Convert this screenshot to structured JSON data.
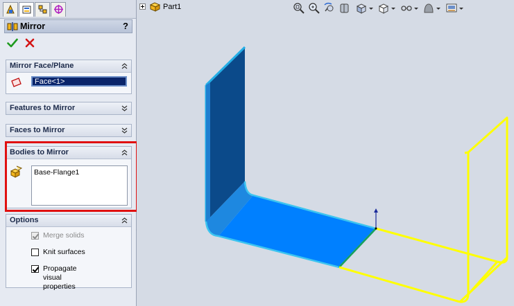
{
  "property_manager": {
    "title": "Mirror",
    "help": "?",
    "groups": {
      "mirror_face_plane": {
        "label": "Mirror Face/Plane",
        "value": "Face<1>"
      },
      "features_to_mirror": {
        "label": "Features to Mirror"
      },
      "faces_to_mirror": {
        "label": "Faces to Mirror"
      },
      "bodies_to_mirror": {
        "label": "Bodies to Mirror",
        "items": [
          "Base-Flange1"
        ]
      },
      "options": {
        "label": "Options",
        "items": [
          {
            "label": "Merge solids",
            "checked": true,
            "enabled": false
          },
          {
            "label": "Knit surfaces",
            "checked": false,
            "enabled": true
          },
          {
            "label": "Propagate visual\nproperties",
            "checked": true,
            "enabled": true
          }
        ]
      }
    }
  },
  "tree": {
    "root": "Part1"
  },
  "icons": {
    "tabs": [
      "feature-manager-icon",
      "property-manager-icon",
      "configuration-manager-icon",
      "dimxpert-manager-icon"
    ],
    "view_toolbar": [
      "zoom-to-fit-icon",
      "zoom-to-area-icon",
      "previous-view-icon",
      "section-view-icon",
      "view-orientation-icon",
      "display-style-icon",
      "hide-show-items-icon",
      "edit-appearance-icon",
      "apply-scene-icon"
    ]
  },
  "colors": {
    "highlight": "#e01010",
    "selected_face": "#0080ff",
    "preview": "#ffff00"
  }
}
